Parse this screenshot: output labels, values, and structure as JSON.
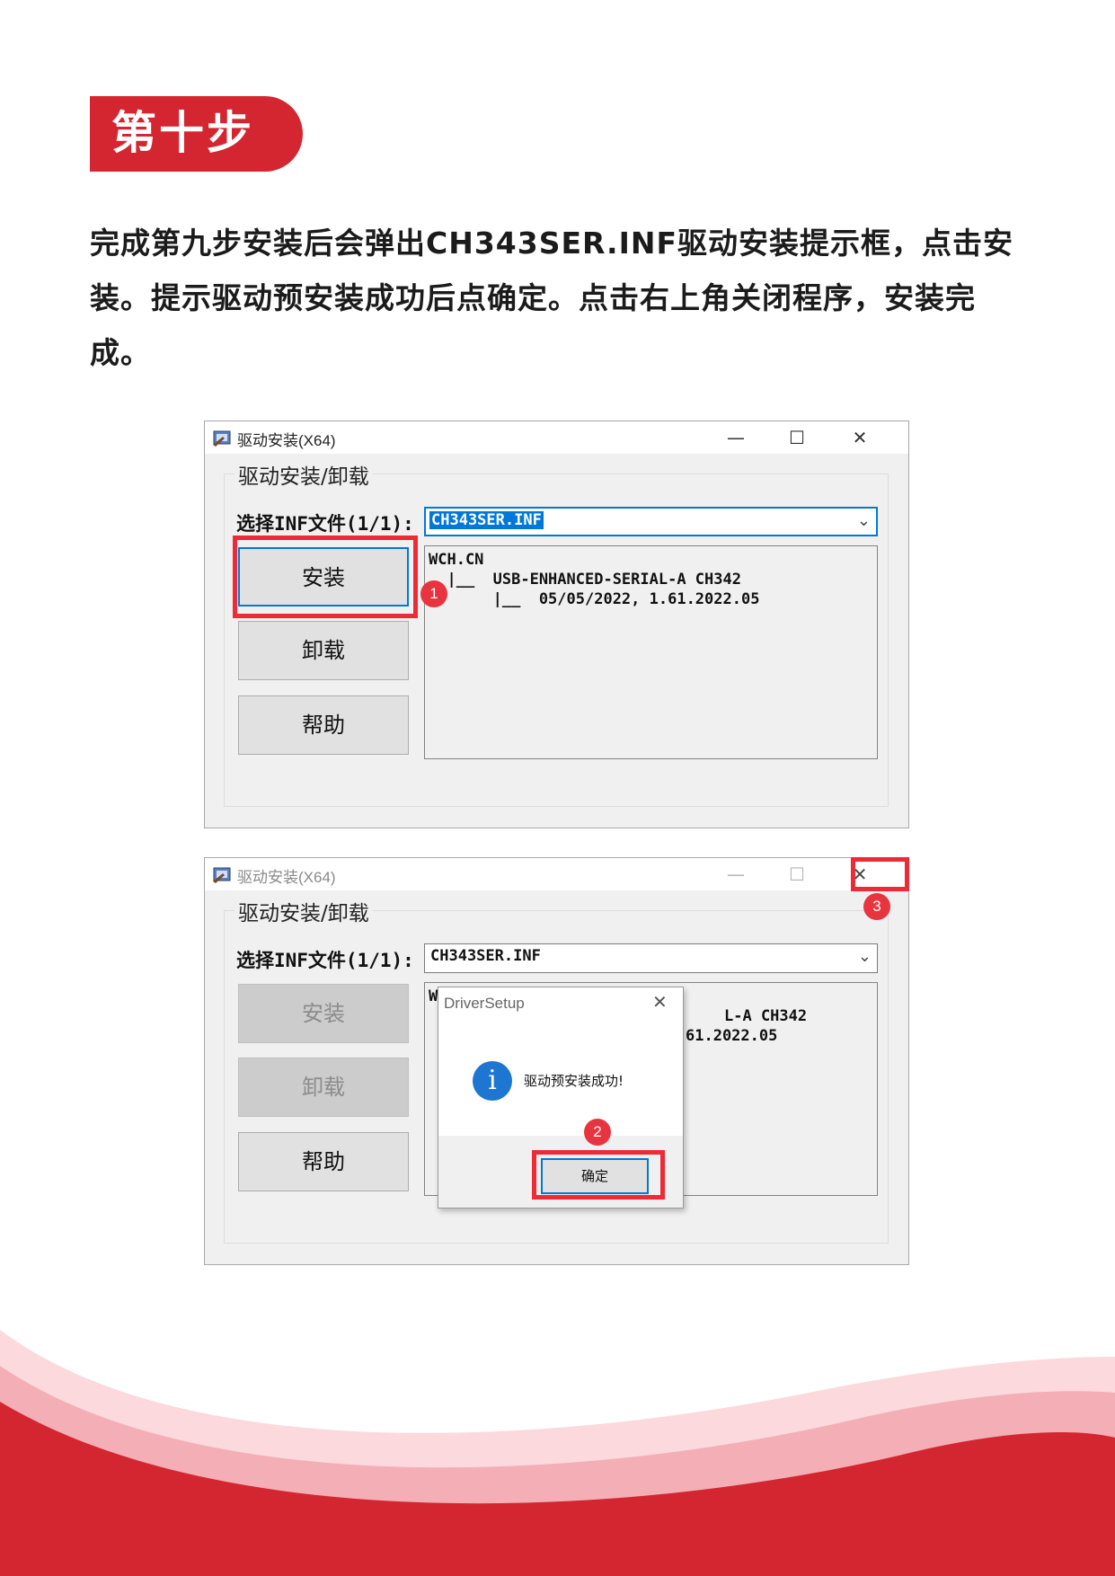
{
  "page": {
    "step_title": "第十步",
    "instruction": "完成第九步安装后会弹出CH343SER.INF驱动安装提示框，点击安装。提示驱动预安装成功后点确定。点击右上角关闭程序，安装完成。"
  },
  "window1": {
    "title": "驱动安装(X64)",
    "min": "—",
    "max": "☐",
    "close": "✕",
    "group_label": "驱动安装/卸载",
    "select_label": "选择INF文件(1/1):",
    "select_value": "CH343SER.INF",
    "buttons": {
      "install": "安装",
      "uninstall": "卸载",
      "help": "帮助"
    },
    "tree": [
      "WCH.CN",
      "  |__  USB-ENHANCED-SERIAL-A CH342",
      "       |__  05/05/2022, 1.61.2022.05"
    ],
    "marker": "1"
  },
  "window2": {
    "title": "驱动安装(X64)",
    "min": "—",
    "max": "☐",
    "close": "✕",
    "group_label": "驱动安装/卸载",
    "select_label": "选择INF文件(1/1):",
    "select_value": "CH343SER.INF",
    "buttons": {
      "install": "安装",
      "uninstall": "卸载",
      "help": "帮助"
    },
    "tree_fragments": [
      "W",
      "L-A CH342",
      "61.2022.05"
    ],
    "marker": "3"
  },
  "dialog": {
    "title": "DriverSetup",
    "close": "✕",
    "icon": "info-icon",
    "icon_glyph": "i",
    "message": "驱动预安装成功!",
    "ok": "确定",
    "marker": "2"
  },
  "colors": {
    "accent_red": "#d32630",
    "highlight_red": "#ee2a36",
    "windows_blue": "#0078d7"
  }
}
